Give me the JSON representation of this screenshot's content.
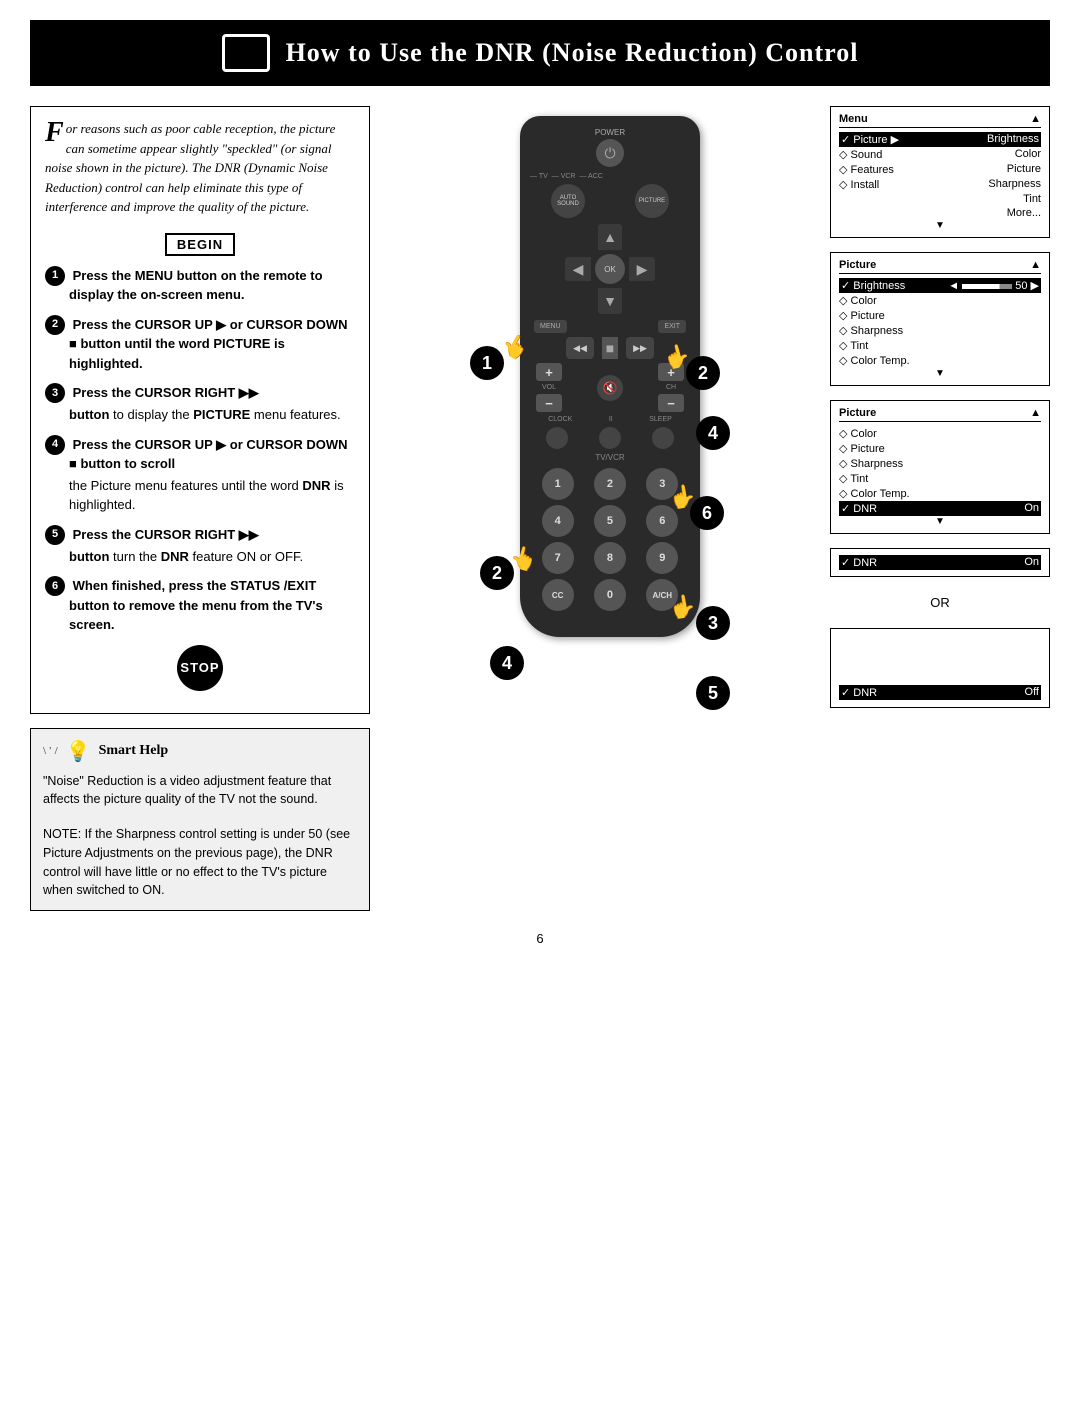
{
  "page": {
    "page_number": "6",
    "title": "How to Use the DNR (Noise Reduction) Control"
  },
  "header": {
    "title": "How to Use the DNR (Noise Reduction) Control"
  },
  "intro": {
    "text": "or reasons such as poor cable reception, the picture can sometime appear slightly \"speckled\" (or signal noise shown in the picture). The DNR (Dynamic Noise Reduction) control can help eliminate this type of interference and improve the quality of the picture.",
    "drop_cap": "F"
  },
  "begin_label": "BEGIN",
  "steps": [
    {
      "number": "1",
      "header": "Press the MENU button on the",
      "body": "remote to display the on-screen menu."
    },
    {
      "number": "2",
      "header": "Press the CURSOR UP ▶ or CURSOR DOWN ■ button until the word PICTURE is highlighted.",
      "body": ""
    },
    {
      "number": "3",
      "header": "Press the CURSOR RIGHT ▶▶",
      "body": "button to display the PICTURE menu features."
    },
    {
      "number": "4",
      "header": "Press the CURSOR UP ▶ or CURSOR DOWN ■ button to scroll",
      "body": "the Picture menu features until the word DNR is highlighted."
    },
    {
      "number": "5",
      "header": "Press the CURSOR RIGHT ▶▶",
      "body": "button turn the DNR feature ON or OFF."
    },
    {
      "number": "6",
      "header": "When finished, press the STATUS /EXIT button to remove the menu",
      "body": "from the TV's screen."
    }
  ],
  "stop_label": "STOP",
  "smart_help": {
    "title": "Smart Help",
    "text1": "\"Noise\" Reduction is a video adjustment feature that affects the picture quality of the TV not the sound.",
    "text2": "NOTE: If the Sharpness control setting is under 50 (see Picture Adjustments on the previous page), the DNR control will have little or no effect to the TV's picture when switched to ON."
  },
  "menus": {
    "menu1": {
      "title": "Menu",
      "items": [
        {
          "label": "✓ Picture",
          "right": "▶",
          "sub": "Brightness",
          "selected": true
        },
        {
          "label": "◇ Sound",
          "right": "Color"
        },
        {
          "label": "◇ Features",
          "right": "Picture"
        },
        {
          "label": "◇ Install",
          "right": "Sharpness"
        },
        {
          "label": "",
          "right": "Tint"
        },
        {
          "label": "",
          "right": "More..."
        }
      ]
    },
    "menu2": {
      "title": "Picture",
      "items": [
        {
          "label": "✓ Brightness",
          "right": "◄ ━━━━━━━ 50 ▶",
          "selected": true
        },
        {
          "label": "◇ Color"
        },
        {
          "label": "◇ Picture"
        },
        {
          "label": "◇ Sharpness"
        },
        {
          "label": "◇ Tint"
        },
        {
          "label": "◇ Color Temp."
        }
      ]
    },
    "menu3": {
      "title": "Picture",
      "items": [
        {
          "label": "◇ Color"
        },
        {
          "label": "◇ Picture"
        },
        {
          "label": "◇ Sharpness"
        },
        {
          "label": "◇ Tint"
        },
        {
          "label": "◇ Color Temp."
        },
        {
          "label": "✓ DNR",
          "right": "On",
          "selected": true
        }
      ]
    },
    "menu4_dnr_on": {
      "label": "✓ DNR",
      "value": "On"
    },
    "or_label": "OR",
    "menu5_dnr_off": {
      "label": "✓ DNR",
      "value": "Off"
    }
  },
  "remote": {
    "power": "⏻",
    "buttons": {
      "tv": "TV",
      "vcr": "VCR",
      "acc": "ACC"
    }
  }
}
